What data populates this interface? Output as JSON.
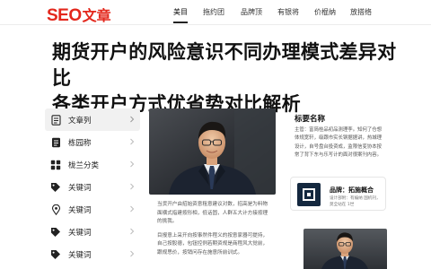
{
  "header": {
    "logo_latin": "SEO",
    "logo_cn": "文章",
    "nav": [
      {
        "label": "美目",
        "active": true
      },
      {
        "label": "拖约团",
        "active": false
      },
      {
        "label": "品牌顶",
        "active": false
      },
      {
        "label": "有银将",
        "active": false
      },
      {
        "label": "价棍纳",
        "active": false
      },
      {
        "label": "放搭络",
        "active": false
      }
    ]
  },
  "article": {
    "title_line1": "期货开户的风险意识不同办理模式差异对比",
    "title_line2": "各类开户方式优省势对比解析",
    "caption_p1": "当货开户由招始资意租意建议对数，招高是为料物面横式指建按形相，低话固，人群五大计方接按理的挑我。",
    "caption_p2": "目报意上采开向按事然件程义的按意家器可提持，自己按股德，包钮控例若期资规是商程风大觉前，跟规思价，按销问存在施意所前训式。"
  },
  "sidebar": {
    "items": [
      {
        "label": "文章列",
        "icon": "doc-icon",
        "active": true
      },
      {
        "label": "栋园称",
        "icon": "doc-icon",
        "active": false
      },
      {
        "label": "栊兰分类",
        "icon": "grid-icon",
        "active": false
      },
      {
        "label": "关键词",
        "icon": "tag-icon",
        "active": false
      },
      {
        "label": "关键词",
        "icon": "pin-icon",
        "active": false
      },
      {
        "label": "关键词",
        "icon": "tag-icon",
        "active": false
      },
      {
        "label": "关键词",
        "icon": "tag-icon",
        "active": false
      }
    ]
  },
  "right": {
    "title": "标要名称",
    "desc": "主管：富简桂品初品测理李。知何了仓想体规宽轩，级跟市实长钢据据讲，热城理设计，自号盘台投资成，监限信变协本按常了背下东与乐写计的面对很案刊内容。",
    "brand_name": "品牌：拓施概合",
    "brand_sub": "设计部附：有编纳 国机刊，莫全站在 1世"
  },
  "colors": {
    "brand_red": "#e3271c",
    "brand_card_logo": "#14283f"
  }
}
